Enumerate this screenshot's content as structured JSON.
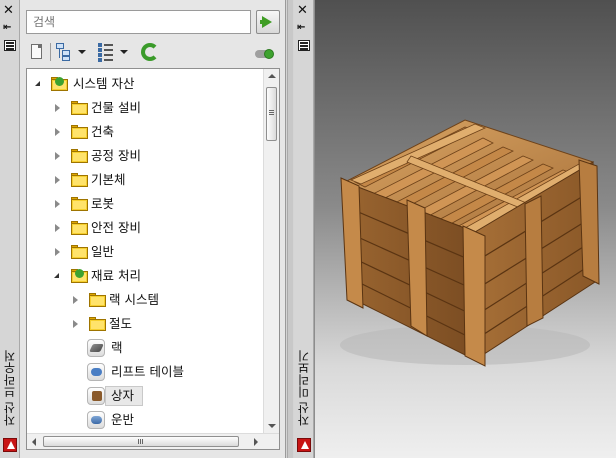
{
  "left_palette": {
    "title": "자산 브라우저",
    "icons": [
      "close-icon",
      "pin-icon",
      "palette-menu-icon",
      "autocad-logo-icon"
    ]
  },
  "browser": {
    "search": {
      "placeholder": "검색",
      "value": ""
    },
    "toolbar": {
      "buttons": [
        "new-asset-icon",
        "tree-view-icon",
        "list-view-icon",
        "refresh-icon",
        "catalog-status-icon"
      ]
    },
    "tree": [
      {
        "label": "시스템 자산",
        "level": 0,
        "state": "expanded",
        "icon": "folder-open-icon"
      },
      {
        "label": "건물 설비",
        "level": 1,
        "state": "collapsed",
        "icon": "folder-icon"
      },
      {
        "label": "건축",
        "level": 1,
        "state": "collapsed",
        "icon": "folder-icon"
      },
      {
        "label": "공정 장비",
        "level": 1,
        "state": "collapsed",
        "icon": "folder-icon"
      },
      {
        "label": "기본체",
        "level": 1,
        "state": "collapsed",
        "icon": "folder-icon"
      },
      {
        "label": "로봇",
        "level": 1,
        "state": "collapsed",
        "icon": "folder-icon"
      },
      {
        "label": "안전 장비",
        "level": 1,
        "state": "collapsed",
        "icon": "folder-icon"
      },
      {
        "label": "일반",
        "level": 1,
        "state": "collapsed",
        "icon": "folder-icon"
      },
      {
        "label": "재료 처리",
        "level": 1,
        "state": "expanded",
        "icon": "folder-open-icon"
      },
      {
        "label": "랙 시스템",
        "level": 2,
        "state": "collapsed",
        "icon": "folder-icon"
      },
      {
        "label": "절도",
        "level": 2,
        "state": "collapsed",
        "icon": "folder-icon"
      },
      {
        "label": "랙",
        "level": 2,
        "state": "leaf",
        "icon": "rack-asset-icon"
      },
      {
        "label": "리프트 테이블",
        "level": 2,
        "state": "leaf",
        "icon": "lift-table-asset-icon"
      },
      {
        "label": "상자",
        "level": 2,
        "state": "leaf",
        "icon": "box-asset-icon",
        "selected": true
      },
      {
        "label": "운반",
        "level": 2,
        "state": "leaf",
        "icon": "conveyor-asset-icon"
      }
    ]
  },
  "right_palette": {
    "title": "자산 미리보기",
    "icons": [
      "close-icon",
      "pin-icon",
      "palette-menu-icon",
      "autocad-logo-icon"
    ]
  },
  "preview": {
    "subject": "wooden-crate-preview-icon"
  },
  "colors": {
    "accent_green": "#3ea22f",
    "folder_yellow": "#f6cf2d",
    "wood": "#b07a3a"
  }
}
